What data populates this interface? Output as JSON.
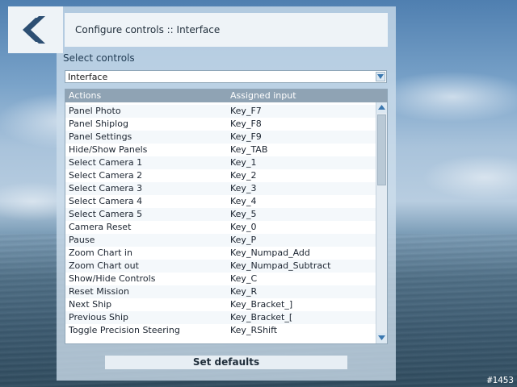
{
  "header": {
    "title": "Configure controls :: Interface"
  },
  "select": {
    "label": "Select controls",
    "value": "Interface"
  },
  "table": {
    "columns": [
      "Actions",
      "Assigned input"
    ],
    "rows": [
      {
        "action": "Panel Photo",
        "input": "Key_F7"
      },
      {
        "action": "Panel Shiplog",
        "input": "Key_F8"
      },
      {
        "action": "Panel Settings",
        "input": "Key_F9"
      },
      {
        "action": "Hide/Show Panels",
        "input": "Key_TAB"
      },
      {
        "action": "Select Camera 1",
        "input": "Key_1"
      },
      {
        "action": "Select Camera 2",
        "input": "Key_2"
      },
      {
        "action": "Select Camera 3",
        "input": "Key_3"
      },
      {
        "action": "Select Camera 4",
        "input": "Key_4"
      },
      {
        "action": "Select Camera 5",
        "input": "Key_5"
      },
      {
        "action": "Camera Reset",
        "input": "Key_0"
      },
      {
        "action": "Pause",
        "input": "Key_P"
      },
      {
        "action": "Zoom Chart in",
        "input": "Key_Numpad_Add"
      },
      {
        "action": "Zoom Chart out",
        "input": "Key_Numpad_Subtract"
      },
      {
        "action": "Show/Hide Controls",
        "input": "Key_C"
      },
      {
        "action": "Reset Mission",
        "input": "Key_R"
      },
      {
        "action": "Next Ship",
        "input": "Key_Bracket_]"
      },
      {
        "action": "Previous Ship",
        "input": "Key_Bracket_["
      },
      {
        "action": "Toggle Precision Steering",
        "input": "Key_RShift"
      }
    ]
  },
  "buttons": {
    "defaults": "Set defaults"
  },
  "frame_label": "#1453",
  "icons": {
    "back": "back-arrow-icon",
    "dropdown": "chevron-down-icon",
    "scroll_up": "chevron-up-icon",
    "scroll_down": "chevron-down-icon"
  },
  "colors": {
    "accent": "#2d4f73",
    "panel": "#cddeec",
    "header_row": "#8fa3b4"
  }
}
